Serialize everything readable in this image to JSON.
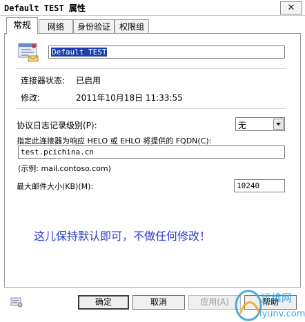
{
  "window": {
    "title": "Default TEST 属性",
    "close_glyph": "✕"
  },
  "tabs": [
    {
      "label": "常规",
      "active": true
    },
    {
      "label": "网络",
      "active": false
    },
    {
      "label": "身份验证",
      "active": false
    },
    {
      "label": "权限组",
      "active": false
    }
  ],
  "general": {
    "name_value": "Default TEST",
    "status_label": "连接器状态:",
    "status_value": "已启用",
    "modified_label": "修改:",
    "modified_value": "2011年10月18日 11:33:55",
    "log_level_label": "协议日志记录级别(P):",
    "log_level_value": "无",
    "fqdn_label": "指定此连接器为响应 HELO 或 EHLO 将提供的 FQDN(C):",
    "fqdn_value": "test.pcichina.cn",
    "fqdn_example": "(示例: mail.contoso.com)",
    "max_size_label": "最大邮件大小(KB)(M):",
    "max_size_value": "10240",
    "annotation": "这儿保持默认即可，不做任何修改！"
  },
  "buttons": {
    "ok": "确定",
    "cancel": "取消",
    "apply": "应用(A)",
    "help": "帮助"
  },
  "watermark": {
    "cn": "运维网",
    "url": "iyunv.com"
  },
  "colors": {
    "annotation": "#2a3cc8",
    "selection": "#1a3fa8",
    "watermark": "#2aa0d8"
  },
  "icons": [
    "connector-icon",
    "close-icon",
    "dropdown-arrow-icon",
    "info-card-icon"
  ]
}
